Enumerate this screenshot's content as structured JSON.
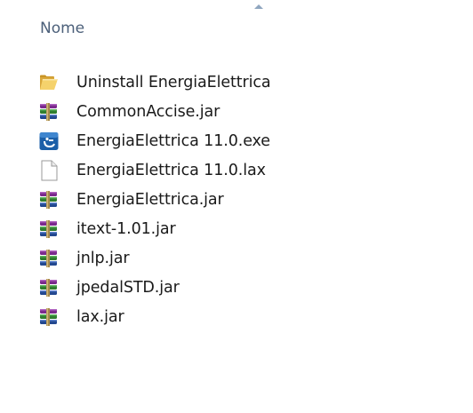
{
  "columns": {
    "name_header": "Nome"
  },
  "files": [
    {
      "name": "Uninstall EnergiaElettrica",
      "icon": "folder-icon"
    },
    {
      "name": "CommonAccise.jar",
      "icon": "winrar-archive-icon"
    },
    {
      "name": "EnergiaElettrica 11.0.exe",
      "icon": "installer-exe-icon"
    },
    {
      "name": "EnergiaElettrica 11.0.lax",
      "icon": "generic-file-icon"
    },
    {
      "name": "EnergiaElettrica.jar",
      "icon": "winrar-archive-icon"
    },
    {
      "name": "itext-1.01.jar",
      "icon": "winrar-archive-icon"
    },
    {
      "name": "jnlp.jar",
      "icon": "winrar-archive-icon"
    },
    {
      "name": "jpedalSTD.jar",
      "icon": "winrar-archive-icon"
    },
    {
      "name": "lax.jar",
      "icon": "winrar-archive-icon"
    }
  ],
  "colors": {
    "header_text": "#4c607a",
    "sort_arrow": "#8fa6bf",
    "file_text": "#1a1a1a",
    "exe_icon_blue": "#1b5fa8"
  }
}
